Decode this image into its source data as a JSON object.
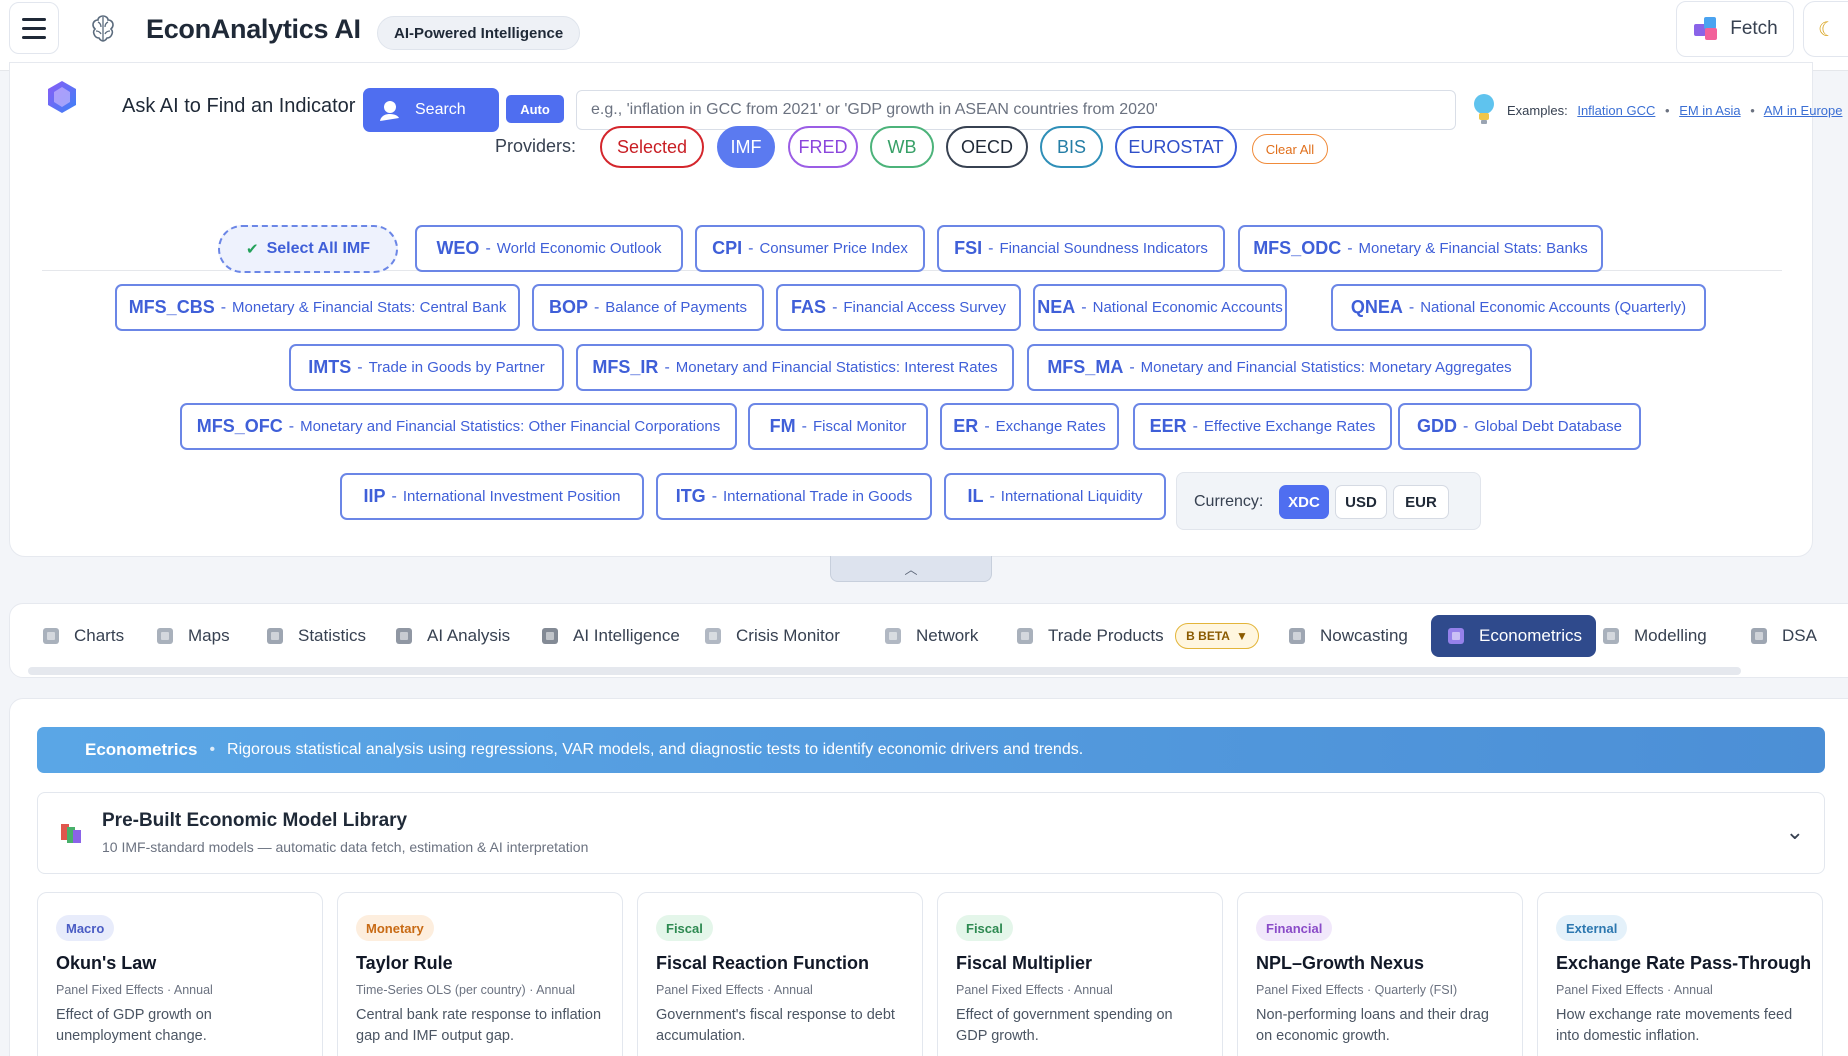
{
  "header": {
    "brand_name": "EconAnalytics AI",
    "brand_pill": "AI-Powered Intelligence",
    "fetch_label": "Fetch",
    "theme_icon": "moon-icon"
  },
  "ask": {
    "title": "Ask AI to Find an Indicator",
    "search_label": "Search",
    "auto_label": "Auto",
    "placeholder": "e.g., 'inflation in GCC from 2021' or 'GDP growth in ASEAN countries from 2020'",
    "examples_label": "Examples:",
    "examples": [
      "Inflation GCC",
      "EM in Asia",
      "AM in Europe"
    ]
  },
  "providers": {
    "label": "Providers:",
    "items": [
      {
        "label": "Selected",
        "color": "#d4262c",
        "fill": "#ffffff",
        "text": "#c81e24"
      },
      {
        "label": "IMF",
        "color": "#5b7af0",
        "fill": "#5b7af0",
        "text": "#ffffff"
      },
      {
        "label": "FRED",
        "color": "#9b5de5",
        "fill": "#ffffff",
        "text": "#8b46dc"
      },
      {
        "label": "WB",
        "color": "#4cb37a",
        "fill": "#ffffff",
        "text": "#37a067"
      },
      {
        "label": "OECD",
        "color": "#374151",
        "fill": "#ffffff",
        "text": "#1f2937"
      },
      {
        "label": "BIS",
        "color": "#2f8fb8",
        "fill": "#ffffff",
        "text": "#257ea6"
      },
      {
        "label": "EUROSTAT",
        "color": "#3b5bd9",
        "fill": "#ffffff",
        "text": "#2f4fc8"
      }
    ],
    "clear_all": "Clear All"
  },
  "datasets": {
    "select_all": "Select All IMF",
    "items": [
      {
        "code": "WEO",
        "name": "World Economic Outlook"
      },
      {
        "code": "CPI",
        "name": "Consumer Price Index"
      },
      {
        "code": "FSI",
        "name": "Financial Soundness Indicators"
      },
      {
        "code": "MFS_ODC",
        "name": "Monetary & Financial Stats: Banks"
      },
      {
        "code": "MFS_CBS",
        "name": "Monetary & Financial Stats: Central Bank"
      },
      {
        "code": "BOP",
        "name": "Balance of Payments"
      },
      {
        "code": "FAS",
        "name": "Financial Access Survey"
      },
      {
        "code": "NEA",
        "name": "National Economic Accounts"
      },
      {
        "code": "QNEA",
        "name": "National Economic Accounts (Quarterly)"
      },
      {
        "code": "IMTS",
        "name": "Trade in Goods by Partner"
      },
      {
        "code": "MFS_IR",
        "name": "Monetary and Financial Statistics: Interest Rates"
      },
      {
        "code": "MFS_MA",
        "name": "Monetary and Financial Statistics: Monetary Aggregates"
      },
      {
        "code": "MFS_OFC",
        "name": "Monetary and Financial Statistics: Other Financial Corporations"
      },
      {
        "code": "FM",
        "name": "Fiscal Monitor"
      },
      {
        "code": "ER",
        "name": "Exchange Rates"
      },
      {
        "code": "EER",
        "name": "Effective Exchange Rates"
      },
      {
        "code": "GDD",
        "name": "Global Debt Database"
      },
      {
        "code": "IIP",
        "name": "International Investment Position"
      },
      {
        "code": "ITG",
        "name": "International Trade in Goods"
      },
      {
        "code": "IL",
        "name": "International Liquidity"
      }
    ]
  },
  "currency": {
    "label": "Currency:",
    "options": [
      "XDC",
      "USD",
      "EUR"
    ],
    "selected": "XDC"
  },
  "tabs": {
    "items": [
      {
        "label": "Charts",
        "icon": "chart-icon"
      },
      {
        "label": "Maps",
        "icon": "map-icon"
      },
      {
        "label": "Statistics",
        "icon": "statistics-icon"
      },
      {
        "label": "AI Analysis",
        "icon": "ai-analysis-icon"
      },
      {
        "label": "AI Intelligence",
        "icon": "ai-intelligence-icon"
      },
      {
        "label": "Crisis Monitor",
        "icon": "crisis-icon"
      },
      {
        "label": "Network",
        "icon": "network-icon"
      },
      {
        "label": "Trade Products",
        "icon": "trade-icon"
      },
      {
        "label": "Nowcasting",
        "icon": "nowcasting-icon"
      },
      {
        "label": "Econometrics",
        "icon": "econometrics-icon"
      },
      {
        "label": "Modelling",
        "icon": "modelling-icon"
      },
      {
        "label": "DSA",
        "icon": "dsa-icon"
      }
    ],
    "beta_label": "B BETA",
    "active": "Econometrics"
  },
  "banner": {
    "title": "Econometrics",
    "description": "Rigorous statistical analysis using regressions, VAR models, and diagnostic tests to identify economic drivers and trends."
  },
  "library": {
    "title": "Pre-Built Economic Model Library",
    "subtitle": "10 IMF-standard models — automatic data fetch, estimation & AI interpretation"
  },
  "models": [
    {
      "tag": "Macro",
      "tag_bg": "#e8ecfb",
      "tag_fg": "#4a5cc4",
      "title": "Okun's Law",
      "meta": "Panel Fixed Effects · Annual",
      "desc": "Effect of GDP growth on unemployment change."
    },
    {
      "tag": "Monetary",
      "tag_bg": "#fdeede",
      "tag_fg": "#c86a14",
      "title": "Taylor Rule",
      "meta": "Time-Series OLS (per country) · Annual",
      "desc": "Central bank rate response to inflation gap and IMF output gap."
    },
    {
      "tag": "Fiscal",
      "tag_bg": "#e4f6ea",
      "tag_fg": "#2e8a52",
      "title": "Fiscal Reaction Function",
      "meta": "Panel Fixed Effects · Annual",
      "desc": "Government's fiscal response to debt accumulation."
    },
    {
      "tag": "Fiscal",
      "tag_bg": "#e4f6ea",
      "tag_fg": "#2e8a52",
      "title": "Fiscal Multiplier",
      "meta": "Panel Fixed Effects · Annual",
      "desc": "Effect of government spending on GDP growth."
    },
    {
      "tag": "Financial",
      "tag_bg": "#f1e8fb",
      "tag_fg": "#8a4bc8",
      "title": "NPL–Growth Nexus",
      "meta": "Panel Fixed Effects · Quarterly (FSI)",
      "desc": "Non-performing loans and their drag on economic growth."
    },
    {
      "tag": "External",
      "tag_bg": "#e4f1fa",
      "tag_fg": "#2d78b0",
      "title": "Exchange Rate Pass-Through",
      "meta": "Panel Fixed Effects · Annual",
      "desc": "How exchange rate movements feed into domestic inflation."
    }
  ]
}
